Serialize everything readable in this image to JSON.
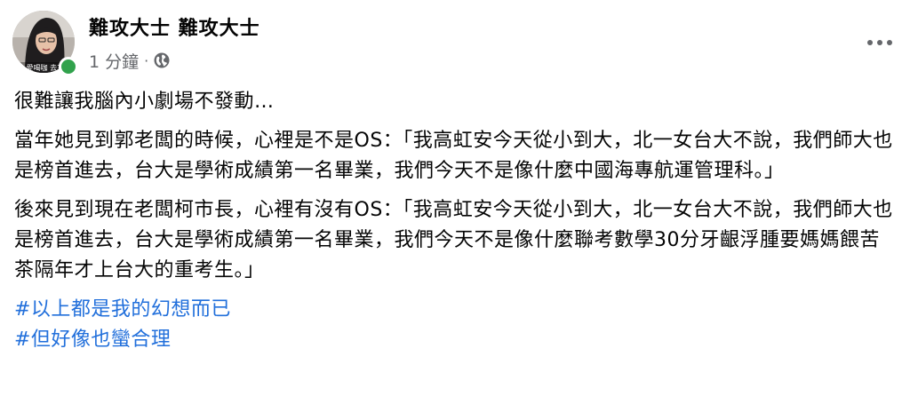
{
  "post": {
    "author": "難攻大士 難攻大士",
    "timestamp": "1 分鐘",
    "separator": "·",
    "privacy_icon": "globe-icon",
    "more_icon": "more-options-icon",
    "avatar_caption": "愛喝咖 去?",
    "online_status_color": "#31a24c",
    "paragraphs": [
      "很難讓我腦內小劇場不發動…",
      "當年她見到郭老闆的時候，心裡是不是OS：「我高虹安今天從小到大，北一女台大不說，我們師大也是榜首進去，台大是學術成績第一名畢業，我們今天不是像什麼中國海專航運管理科。」",
      "後來見到現在老闆柯市長，心裡有沒有OS：「我高虹安今天從小到大，北一女台大不說，我們師大也是榜首進去，台大是學術成績第一名畢業，我們今天不是像什麼聯考數學30分牙齦浮腫要媽媽餵苦茶隔年才上台大的重考生。」"
    ],
    "hashtags": [
      "#以上都是我的幻想而已",
      "#但好像也蠻合理"
    ],
    "hashtag_color": "#216fdb"
  }
}
